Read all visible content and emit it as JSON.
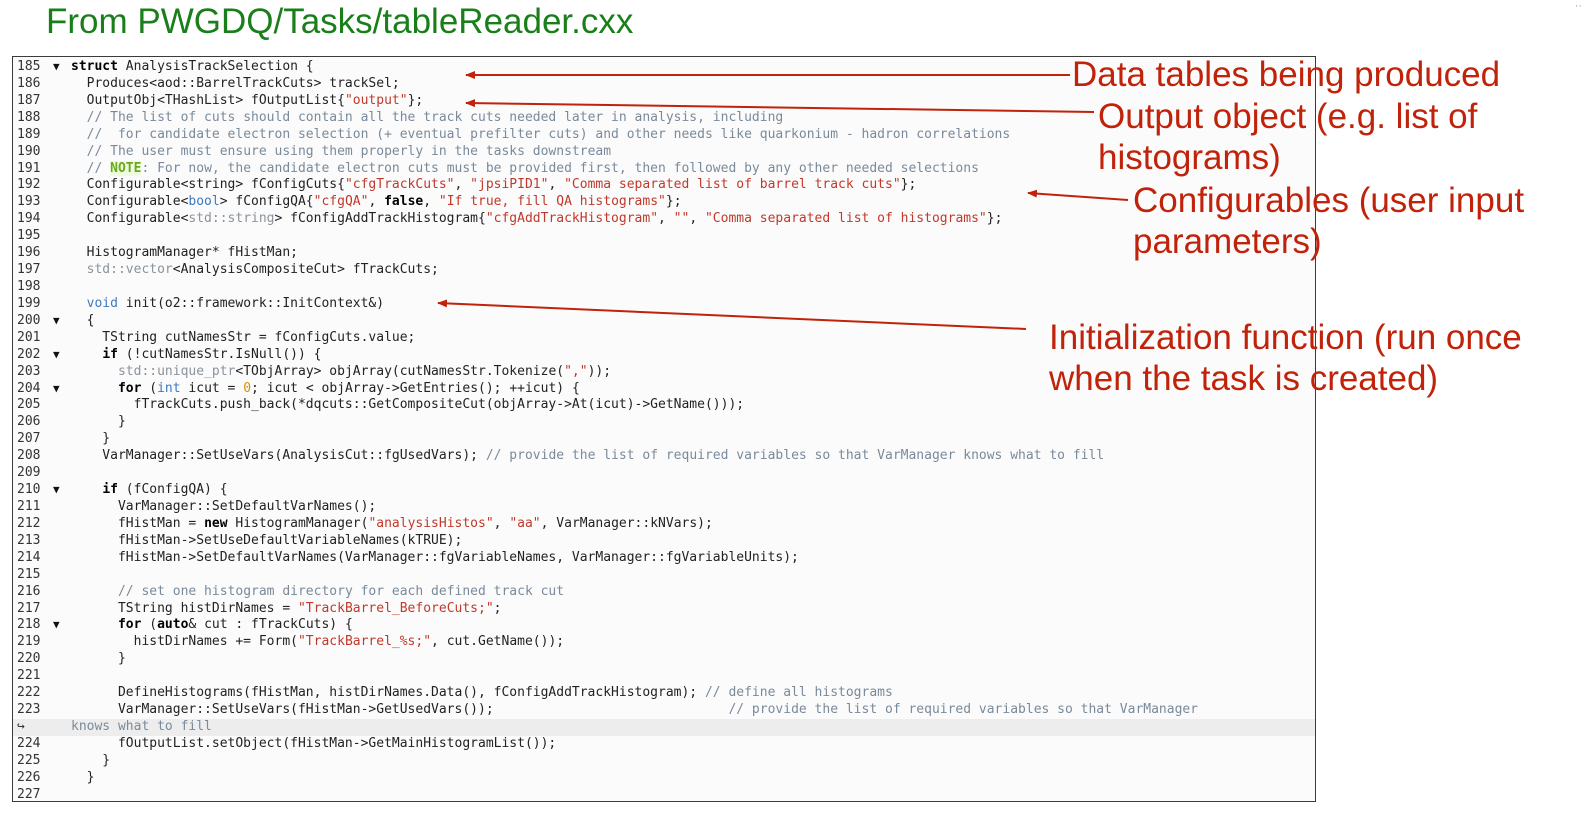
{
  "slide": {
    "title": "From PWGDQ/Tasks/tableReader.cxx",
    "corner_mark": "··"
  },
  "code": {
    "lines": [
      {
        "num": "185",
        "fold": "▼",
        "html": "<span class=\"kw\">struct</span> AnalysisTrackSelection {"
      },
      {
        "num": "186",
        "fold": "",
        "html": "  Produces&lt;aod::BarrelTrackCuts&gt; trackSel;"
      },
      {
        "num": "187",
        "fold": "",
        "html": "  OutputObj&lt;THashList&gt; fOutputList{<span class=\"str\">\"output\"</span>};"
      },
      {
        "num": "188",
        "fold": "",
        "html": "  <span class=\"cmt\">// The list of cuts should contain all the track cuts needed later in analysis, including</span>"
      },
      {
        "num": "189",
        "fold": "",
        "html": "  <span class=\"cmt\">//  for candidate electron selection (+ eventual prefilter cuts) and other needs like quarkonium - hadron correlations</span>"
      },
      {
        "num": "190",
        "fold": "",
        "html": "  <span class=\"cmt\">// The user must ensure using them properly in the tasks downstream</span>"
      },
      {
        "num": "191",
        "fold": "",
        "html": "  <span class=\"cmt\">// </span><span class=\"note\">NOTE</span><span class=\"cmt\">: For now, the candidate electron cuts must be provided first, then followed by any other needed selections</span>"
      },
      {
        "num": "192",
        "fold": "",
        "html": "  Configurable&lt;string&gt; fConfigCuts{<span class=\"str\">\"cfgTrackCuts\"</span>, <span class=\"str\">\"jpsiPID1\"</span>, <span class=\"str\">\"Comma separated list of barrel track cuts\"</span>};"
      },
      {
        "num": "193",
        "fold": "",
        "html": "  Configurable&lt;<span class=\"typ\">bool</span>&gt; fConfigQA{<span class=\"str\">\"cfgQA\"</span>, <span class=\"kw\">false</span>, <span class=\"str\">\"If true, fill QA histograms\"</span>};"
      },
      {
        "num": "194",
        "fold": "",
        "html": "  Configurable&lt;<span class=\"std\">std::string</span>&gt; fConfigAddTrackHistogram{<span class=\"str\">\"cfgAddTrackHistogram\"</span>, <span class=\"str\">\"\"</span>, <span class=\"str\">\"Comma separated list of histograms\"</span>};"
      },
      {
        "num": "195",
        "fold": "",
        "html": ""
      },
      {
        "num": "196",
        "fold": "",
        "html": "  HistogramManager* fHistMan;"
      },
      {
        "num": "197",
        "fold": "",
        "html": "  <span class=\"std\">std::vector</span>&lt;AnalysisCompositeCut&gt; fTrackCuts;"
      },
      {
        "num": "198",
        "fold": "",
        "html": ""
      },
      {
        "num": "199",
        "fold": "",
        "html": "  <span class=\"typ\">void</span> init(o2::framework::InitContext&amp;)"
      },
      {
        "num": "200",
        "fold": "▼",
        "html": "  {"
      },
      {
        "num": "201",
        "fold": "",
        "html": "    TString cutNamesStr = fConfigCuts.value;"
      },
      {
        "num": "202",
        "fold": "▼",
        "html": "    <span class=\"kw\">if</span> (!cutNamesStr.IsNull()) {"
      },
      {
        "num": "203",
        "fold": "",
        "html": "      <span class=\"std\">std::unique_ptr</span>&lt;TObjArray&gt; objArray(cutNamesStr.Tokenize(<span class=\"str\">\",\"</span>));"
      },
      {
        "num": "204",
        "fold": "▼",
        "html": "      <span class=\"kw\">for</span> (<span class=\"typ\">int</span> icut = <span class=\"num\">0</span>; icut &lt; objArray-&gt;GetEntries(); ++icut) {"
      },
      {
        "num": "205",
        "fold": "",
        "html": "        fTrackCuts.push_back(*dqcuts::GetCompositeCut(objArray-&gt;At(icut)-&gt;GetName()));"
      },
      {
        "num": "206",
        "fold": "",
        "html": "      }"
      },
      {
        "num": "207",
        "fold": "",
        "html": "    }"
      },
      {
        "num": "208",
        "fold": "",
        "html": "    VarManager::SetUseVars(AnalysisCut::fgUsedVars); <span class=\"cmt\">// provide the list of required variables so that VarManager knows what to fill</span>"
      },
      {
        "num": "209",
        "fold": "",
        "html": ""
      },
      {
        "num": "210",
        "fold": "▼",
        "html": "    <span class=\"kw\">if</span> (fConfigQA) {"
      },
      {
        "num": "211",
        "fold": "",
        "html": "      VarManager::SetDefaultVarNames();"
      },
      {
        "num": "212",
        "fold": "",
        "html": "      fHistMan = <span class=\"kw\">new</span> HistogramManager(<span class=\"str\">\"analysisHistos\"</span>, <span class=\"str\">\"aa\"</span>, VarManager::kNVars);"
      },
      {
        "num": "213",
        "fold": "",
        "html": "      fHistMan-&gt;SetUseDefaultVariableNames(kTRUE);"
      },
      {
        "num": "214",
        "fold": "",
        "html": "      fHistMan-&gt;SetDefaultVarNames(VarManager::fgVariableNames, VarManager::fgVariableUnits);"
      },
      {
        "num": "215",
        "fold": "",
        "html": ""
      },
      {
        "num": "216",
        "fold": "",
        "html": "      <span class=\"cmt\">// set one histogram directory for each defined track cut</span>"
      },
      {
        "num": "217",
        "fold": "",
        "html": "      TString histDirNames = <span class=\"str\">\"TrackBarrel_BeforeCuts;\"</span>;"
      },
      {
        "num": "218",
        "fold": "▼",
        "html": "      <span class=\"kw\">for</span> (<span class=\"kw\">auto</span>&amp; cut : fTrackCuts) {"
      },
      {
        "num": "219",
        "fold": "",
        "html": "        histDirNames += Form(<span class=\"str\">\"TrackBarrel_%s;\"</span>, cut.GetName());"
      },
      {
        "num": "220",
        "fold": "",
        "html": "      }"
      },
      {
        "num": "221",
        "fold": "",
        "html": ""
      },
      {
        "num": "222",
        "fold": "",
        "html": "      DefineHistograms(fHistMan, histDirNames.Data(), fConfigAddTrackHistogram); <span class=\"cmt\">// define all histograms</span>"
      },
      {
        "num": "223",
        "fold": "",
        "html": "      VarManager::SetUseVars(fHistMan-&gt;GetUsedVars());                              <span class=\"cmt\">// provide the list of required variables so that VarManager</span>"
      },
      {
        "num": "↪",
        "fold": "",
        "html": "<span class=\"cmt\">knows what to fill</span>",
        "wrapped": true
      },
      {
        "num": "224",
        "fold": "",
        "html": "      fOutputList.setObject(fHistMan-&gt;GetMainHistogramList());"
      },
      {
        "num": "225",
        "fold": "",
        "html": "    }"
      },
      {
        "num": "226",
        "fold": "",
        "html": "  }"
      },
      {
        "num": "227",
        "fold": "",
        "html": ""
      }
    ]
  },
  "annotations": {
    "data_tables": "Data tables being produced",
    "output_object_1": "Output object (e.g. list of",
    "output_object_2": "histograms)",
    "configurables_1": "Configurables (user input",
    "configurables_2": "parameters)",
    "init_function_1": "Initialization function (run once",
    "init_function_2": "when the task is created)",
    "color": "#c0220a"
  }
}
